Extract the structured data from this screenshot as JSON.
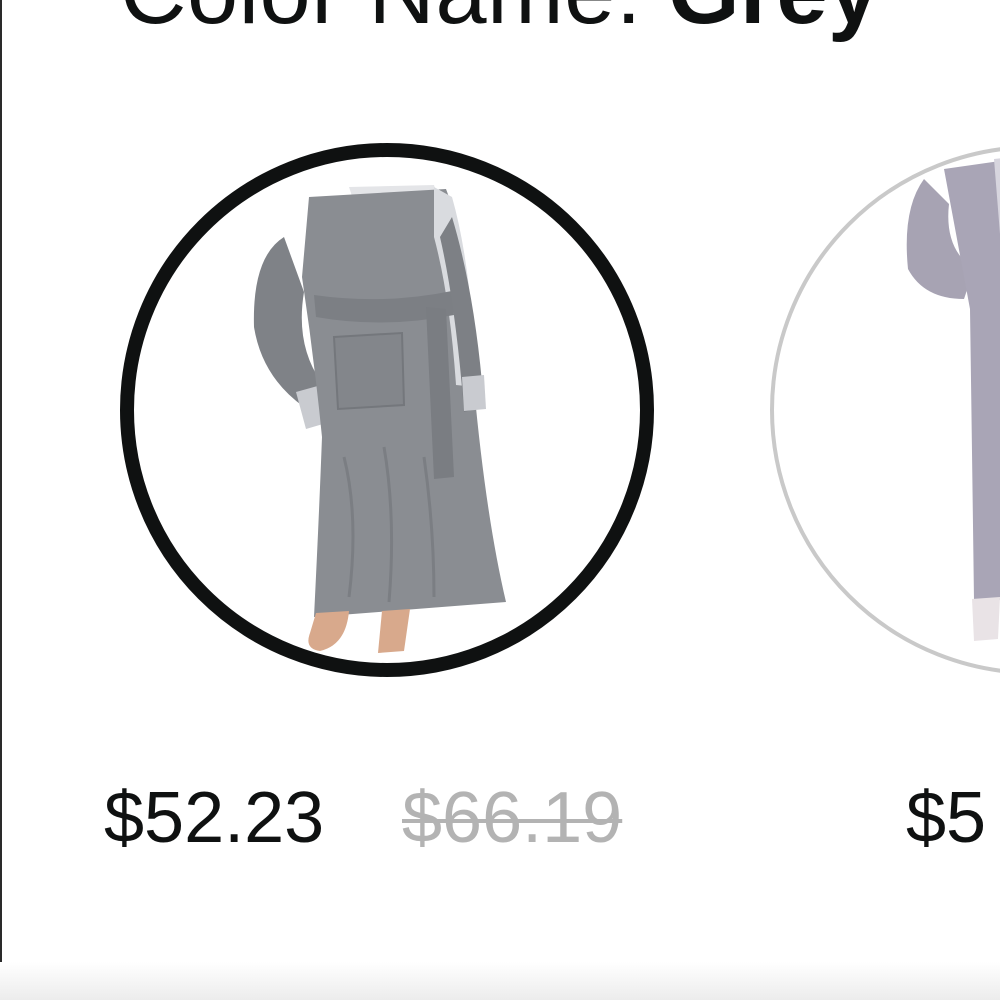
{
  "color_selector": {
    "label": "Color Name:",
    "selected_value": "Grey"
  },
  "swatches": [
    {
      "name": "Grey",
      "price": "$52.23",
      "list_price": "$66.19",
      "selected": true,
      "image_icon": "grey-robe-image"
    },
    {
      "name": "",
      "price": "$5",
      "selected": false,
      "image_icon": "lavender-grey-robe-image"
    }
  ],
  "colors": {
    "selected_border": "#0f1111",
    "unselected_border": "#c9c9c9",
    "price_text": "#0f1111",
    "list_price_text": "#b3b3b3",
    "robe_grey": "#8a8d92",
    "robe_lavender": "#a7a3b3"
  }
}
